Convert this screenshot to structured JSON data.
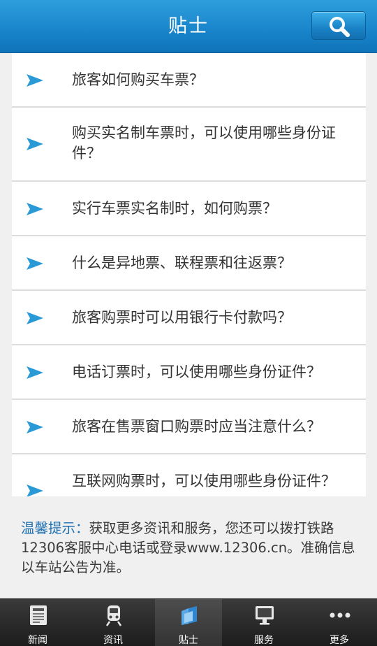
{
  "header": {
    "title": "贴士"
  },
  "faq": [
    {
      "text": "旅客如何购买车票？"
    },
    {
      "text": "购买实名制车票时，可以使用哪些身份证件？"
    },
    {
      "text": "实行车票实名制时，如何购票？"
    },
    {
      "text": "什么是异地票、联程票和往返票？"
    },
    {
      "text": "旅客购票时可以用银行卡付款吗？"
    },
    {
      "text": "电话订票时，可以使用哪些身份证件？"
    },
    {
      "text": "旅客在售票窗口购票时应当注意什么？"
    },
    {
      "text": "互联网购票时，可以使用哪些身份证件？"
    }
  ],
  "tip": {
    "label": "温馨提示：",
    "text": "获取更多资讯和服务，您还可以拨打铁路12306客服中心电话或登录www.12306.cn。准确信息以车站公告为准。"
  },
  "nav": [
    {
      "label": "新闻",
      "icon": "newspaper-icon"
    },
    {
      "label": "资讯",
      "icon": "train-icon"
    },
    {
      "label": "贴士",
      "icon": "tips-icon",
      "active": true
    },
    {
      "label": "服务",
      "icon": "monitor-icon"
    },
    {
      "label": "更多",
      "icon": "more-icon"
    }
  ],
  "colors": {
    "header": "#1a86cc",
    "arrow": "#2a9ad6",
    "tip_label": "#1e6fb0",
    "nav_bg": "#262626"
  }
}
